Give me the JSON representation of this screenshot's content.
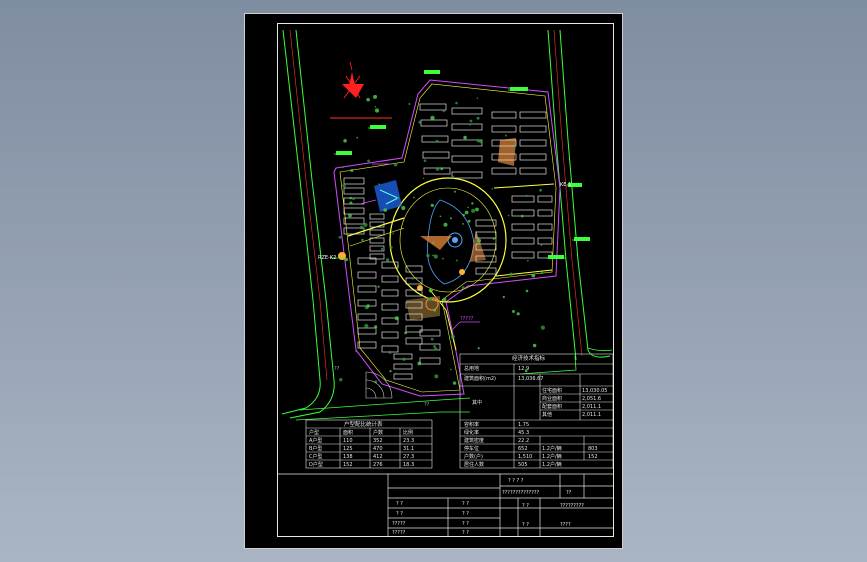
{
  "plan": {
    "label_site_entrance": "RZE-K2",
    "label_east_gate": "KE-1",
    "label_marker": "?????",
    "labels_south": [
      "??",
      "??"
    ]
  },
  "econ_table": {
    "title": "经济技术指标",
    "rows": [
      {
        "label": "总用地",
        "value": "12.9"
      },
      {
        "label": "建筑面积(m2)",
        "value": "13,036.67"
      },
      {
        "label": "其中",
        "sub": [
          {
            "label": "住宅面积",
            "value": "13,030.05"
          },
          {
            "label": "商业面积",
            "value": "2,051.6"
          },
          {
            "label": "配套面积",
            "value": "2,011.1"
          },
          {
            "label": "其他",
            "value": "2,011.1"
          }
        ]
      },
      {
        "label": "容积率",
        "value": "1.75"
      },
      {
        "label": "绿化率",
        "value": "45.3"
      },
      {
        "label": "建筑密度",
        "value": "22.2"
      },
      {
        "label": "停车位",
        "value": "652",
        "extra": "1.2户/辆",
        "extra_val": "803"
      },
      {
        "label": "户数(户)",
        "value": "1,510",
        "extra": "1.2户/辆",
        "extra_val": "152"
      },
      {
        "label": "居住人数",
        "value": "505",
        "extra": "1.2户/辆"
      }
    ]
  },
  "unit_table": {
    "title": "户型配比统计表",
    "header": [
      "户型",
      "面积",
      "户数",
      "比例"
    ],
    "rows": [
      [
        "A户型",
        "110",
        "352",
        "23.3"
      ],
      [
        "B户型",
        "125",
        "470",
        "31.1"
      ],
      [
        "C户型",
        "138",
        "412",
        "27.3"
      ],
      [
        "D户型",
        "152",
        "276",
        "18.3"
      ]
    ]
  },
  "title_block": {
    "project": "? ? ? ?",
    "project_sub": "??????????????",
    "project_code": "??",
    "drawing_name": "?????????",
    "drawing_no": "????",
    "cells_left": [
      "? ?",
      "? ?",
      "?????",
      "?????"
    ],
    "cells_mid": [
      "? ?",
      "? ?",
      "? ?",
      "? ?"
    ],
    "cells_right": [
      "? ?",
      "? ?"
    ]
  }
}
